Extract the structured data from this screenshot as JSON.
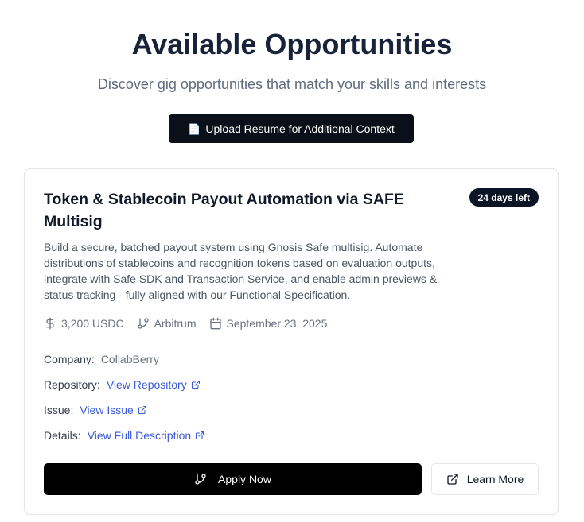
{
  "header": {
    "title": "Available Opportunities",
    "subtitle": "Discover gig opportunities that match your skills and interests",
    "upload_label": "Upload Resume for Additional Context",
    "upload_icon": "📄"
  },
  "card": {
    "title": "Token & Stablecoin Payout Automation via SAFE Multisig",
    "badge": "24 days left",
    "description": "Build a secure, batched payout system using Gnosis Safe multisig. Automate distributions of stablecoins and recognition tokens based on evaluation outputs, integrate with Safe SDK and Transaction Service, and enable admin previews & status tracking - fully aligned with our Functional Specification.",
    "meta": {
      "amount": "3,200 USDC",
      "network": "Arbitrum",
      "date": "September 23, 2025"
    },
    "company_label": "Company:",
    "company_value": "CollabBerry",
    "repository_label": "Repository:",
    "repository_link": "View Repository",
    "issue_label": "Issue:",
    "issue_link": "View Issue",
    "details_label": "Details:",
    "details_link": "View Full Description",
    "apply_label": "Apply Now",
    "learn_label": "Learn More"
  },
  "colors": {
    "primary_button": "#000000",
    "link": "#3b5bd9",
    "badge_bg": "#0b1526"
  }
}
